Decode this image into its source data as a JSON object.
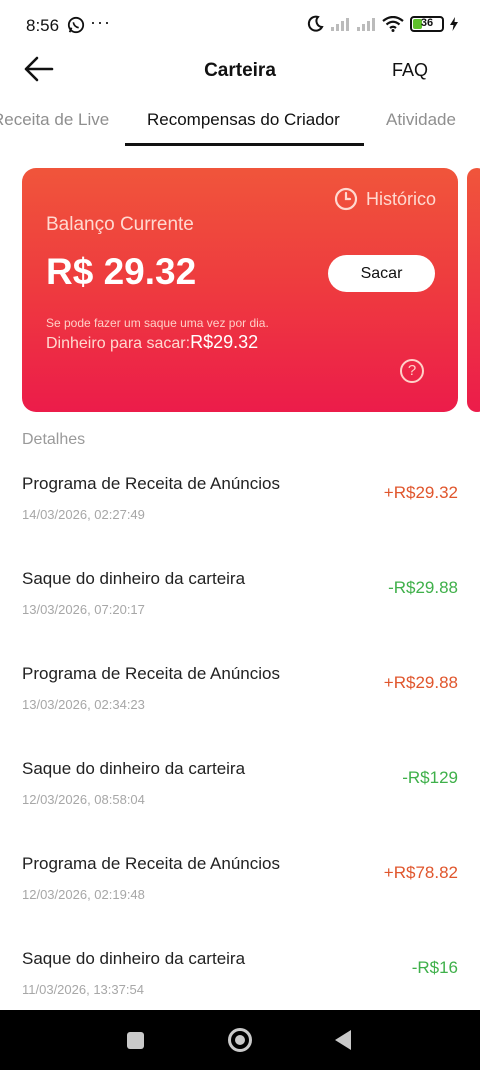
{
  "status_bar": {
    "time": "8:56",
    "more_icons": "···",
    "battery": "36",
    "battery_level": 0.36
  },
  "header": {
    "title": "Carteira",
    "faq": "FAQ"
  },
  "tabs": [
    {
      "label": "Receita de Live"
    },
    {
      "label": "Recompensas do Criador",
      "active": true
    },
    {
      "label": "Atividade"
    }
  ],
  "balance_card": {
    "history_label": "Histórico",
    "label": "Balanço Currente",
    "value": "R$ 29.32",
    "withdraw_button": "Sacar",
    "note": "Se pode fazer um saque uma vez por dia.",
    "available_label": "Dinheiro para sacar:",
    "available_value": "R$29.32",
    "help": "?"
  },
  "details": {
    "title": "Detalhes",
    "items": [
      {
        "title": "Programa de Receita de Anúncios",
        "date": "14/03/2026, 02:27:49",
        "amount": "+R$29.32",
        "type": "credit"
      },
      {
        "title": "Saque do dinheiro da carteira",
        "date": "13/03/2026, 07:20:17",
        "amount": "-R$29.88",
        "type": "debit"
      },
      {
        "title": "Programa de Receita de Anúncios",
        "date": "13/03/2026, 02:34:23",
        "amount": "+R$29.88",
        "type": "credit"
      },
      {
        "title": "Saque do dinheiro da carteira",
        "date": "12/03/2026, 08:58:04",
        "amount": "-R$129",
        "type": "debit"
      },
      {
        "title": "Programa de Receita de Anúncios",
        "date": "12/03/2026, 02:19:48",
        "amount": "+R$78.82",
        "type": "credit"
      },
      {
        "title": "Saque do dinheiro da carteira",
        "date": "11/03/2026, 13:37:54",
        "amount": "-R$16",
        "type": "debit"
      }
    ]
  },
  "colors": {
    "card_top": "#f0553b",
    "card_bottom": "#ec1c4a",
    "credit": "#e0562d",
    "debit": "#3fb04a"
  },
  "icons": {
    "back": "arrow-left-icon",
    "history": "clock-icon",
    "help": "question-circle-icon",
    "nav_recents": "square-icon",
    "nav_home": "circle-icon",
    "nav_back": "triangle-back-icon"
  }
}
